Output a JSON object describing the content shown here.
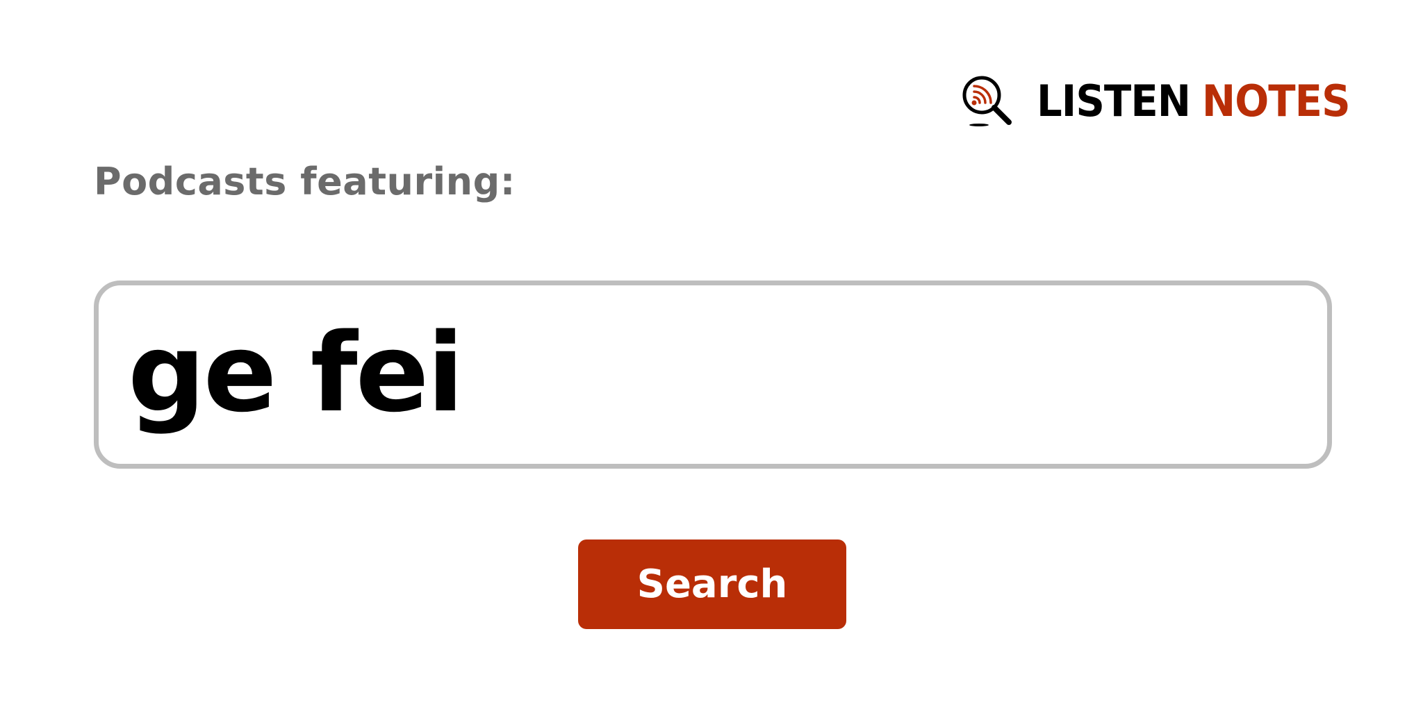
{
  "logo": {
    "word1": "LISTEN",
    "word2": "NOTES",
    "icon": "magnifier-rss-icon",
    "colors": {
      "primary": "#000000",
      "accent": "#b92e07"
    }
  },
  "heading": "Podcasts featuring:",
  "search": {
    "value": "ge fei",
    "border_color": "#bebebe"
  },
  "button": {
    "label": "Search",
    "color": "#b92e07",
    "text_color": "#ffffff"
  }
}
